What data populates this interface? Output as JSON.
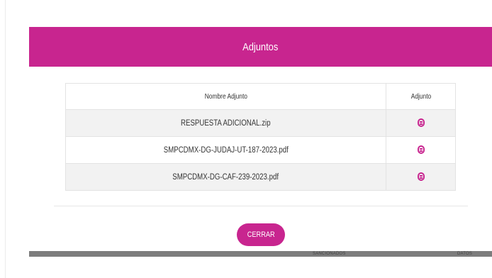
{
  "modal": {
    "title": "Adjuntos",
    "table": {
      "headers": {
        "name": "Nombre Adjunto",
        "attachment": "Adjunto"
      },
      "rows": [
        {
          "name": "RESPUESTA ADICIONAL.zip",
          "icon": "file-icon"
        },
        {
          "name": "SMPCDMX-DG-JUDAJ-UT-187-2023.pdf",
          "icon": "file-icon"
        },
        {
          "name": "SMPCDMX-DG-CAF-239-2023.pdf",
          "icon": "file-icon"
        }
      ]
    },
    "close_label": "CERRAR"
  },
  "background": {
    "col_a": "SANCIONADOS",
    "col_b": "DATOS"
  },
  "colors": {
    "accent": "#c8258f",
    "row_alt": "#f2f2f2",
    "border": "#e3e3e3"
  }
}
